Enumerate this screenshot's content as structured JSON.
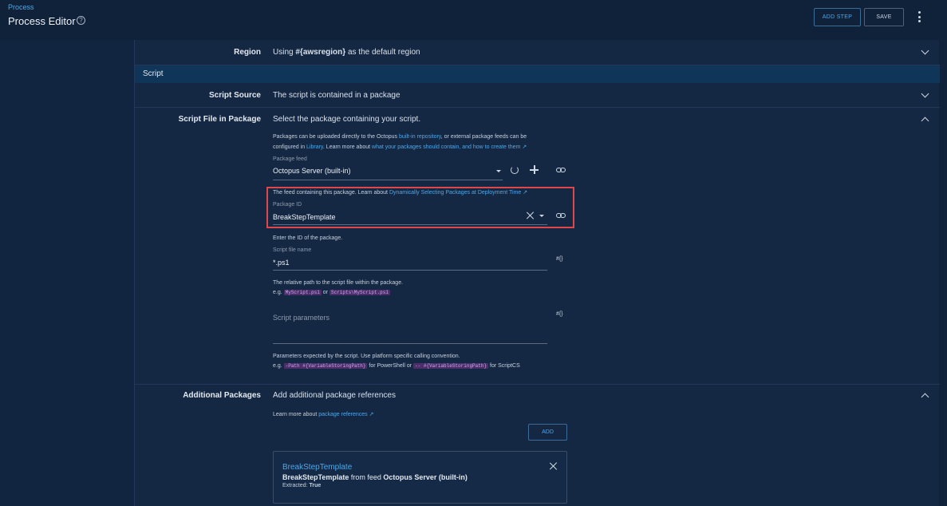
{
  "header": {
    "breadcrumb": "Process",
    "title": "Process Editor",
    "help_icon": "?",
    "add_step_label": "ADD STEP",
    "save_label": "SAVE"
  },
  "rows": {
    "region": {
      "label": "Region",
      "value_pre": "Using ",
      "value_var": "#{awsregion}",
      "value_post": " as the default region"
    },
    "section_title": "Script",
    "script_source": {
      "label": "Script Source",
      "value": "The script is contained in a package"
    },
    "script_file": {
      "label": "Script File in Package",
      "value": "Select the package containing your script."
    },
    "additional": {
      "label": "Additional Packages",
      "value": "Add additional package references"
    }
  },
  "script_file": {
    "intro_1a": "Packages can be uploaded directly to the Octopus ",
    "intro_1_link": "built-in repository",
    "intro_1b": ", or external package feeds can be",
    "intro_2a": "configured in ",
    "intro_2_link1": "Library",
    "intro_2b": ". Learn more about ",
    "intro_2_link2": "what your packages should contain, and how to create them",
    "feed_label": "Package feed",
    "feed_value": "Octopus Server (built-in)",
    "feed_help_a": "The feed containing this package. Learn about ",
    "feed_help_link": "Dynamically Selecting Packages at Deployment Time",
    "pkg_label": "Package ID",
    "pkg_value": "BreakStepTemplate",
    "pkg_help": "Enter the ID of the package.",
    "file_label": "Script file name",
    "file_value": "*.ps1",
    "var_icon": "#{}",
    "file_help_1": "The relative path to the script file within the package.",
    "file_help_eg": "e.g. ",
    "file_help_code1": "MyScript.ps1",
    "file_help_or": " or ",
    "file_help_code2": "Scripts\\MyScript.ps1",
    "params_placeholder": "Script parameters",
    "params_help_1": "Parameters expected by the script. Use platform specific calling convention.",
    "params_help_eg": "e.g. ",
    "params_code1": "-Path #{VariableStoringPath}",
    "params_mid": " for PowerShell or ",
    "params_code2": "-- #{VariableStoringPath}",
    "params_end": " for ScriptCS"
  },
  "additional": {
    "learn_a": "Learn more about ",
    "learn_link": "package references",
    "add_label": "ADD",
    "card_title": "BreakStepTemplate",
    "card_pkg": "BreakStepTemplate",
    "card_from": " from feed ",
    "card_feed": "Octopus Server (built-in)",
    "card_extracted_label": "Extracted: ",
    "card_extracted_value": "True"
  },
  "colors": {
    "accent": "#4ea7e8",
    "highlight": "#e0474d",
    "panel": "#142844",
    "section": "#0f3559"
  }
}
